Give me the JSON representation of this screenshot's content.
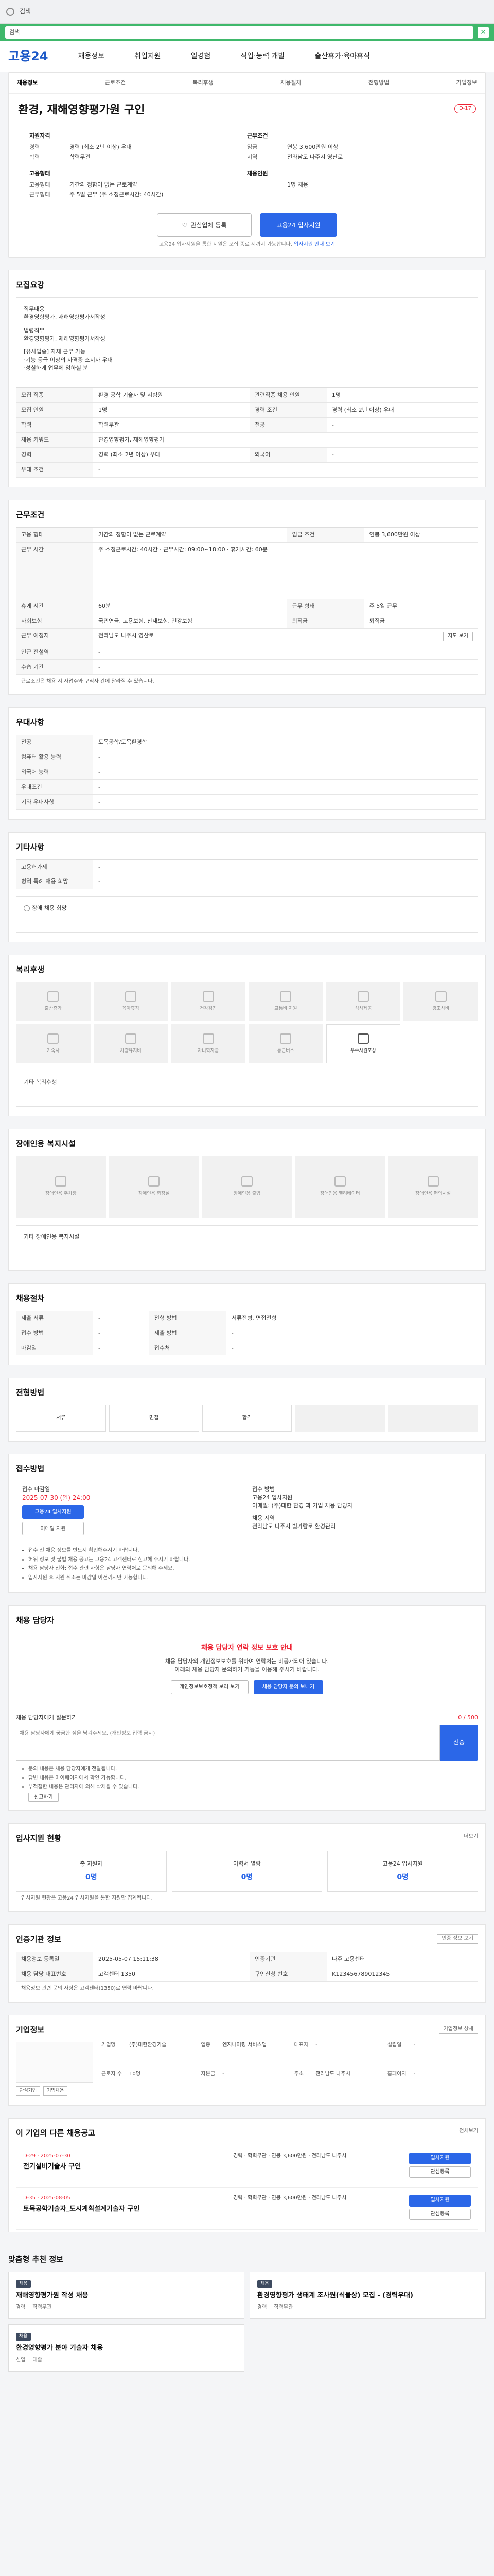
{
  "browser": {
    "search_text": "검색"
  },
  "top": {
    "search_text": "검색"
  },
  "gnb": {
    "logo": "고용24",
    "menus": [
      "채용정보",
      "취업지원",
      "일경험",
      "직업·능력 개발",
      "출산휴가·육아휴직"
    ]
  },
  "subnav": [
    "채용정보",
    "근로조건",
    "복리후생",
    "채용절차",
    "전형방법",
    "기업정보"
  ],
  "job": {
    "title": "환경, 재해영향평가원 구인",
    "badge": "D-17",
    "summary_left_title": "지원자격",
    "summary_left": [
      {
        "k": "경력",
        "v": "경력 (최소 2년 이상) 우대"
      },
      {
        "k": "학력",
        "v": "학력무관"
      }
    ],
    "summary_right_title": "근무조건",
    "summary_right": [
      {
        "k": "임금",
        "v": "연봉 3,600만원 이상"
      },
      {
        "k": "지역",
        "v": "전라남도 나주시 영산로"
      }
    ],
    "summary_left2_title": "고용형태",
    "summary_left2": [
      {
        "k": "고용형태",
        "v": "기간의 정함이 없는 근로계약"
      },
      {
        "k": "근무형태",
        "v": "주 5일 근무 (주 소정근로시간: 40시간)"
      }
    ],
    "summary_right2_title": "채용인원",
    "summary_right2": [
      {
        "k": "",
        "v": "1명 채용"
      }
    ],
    "scrap_btn": "관심업체 등록",
    "apply_btn": "고용24 입사지원",
    "note_pre": "고용24 입사지원을 통한 지원은 모집 종료 시까지 가능합니다.",
    "note_link": "입사지원 안내 보기"
  },
  "s_qual": {
    "title": "모집요강",
    "desc_lines": [
      "직무내용",
      "환경영향평가, 재해영향평가서작성",
      "",
      "법령직무",
      "환경영향평가, 재해영향평가서작성",
      "",
      "[유사업종] 자체 근무 가능",
      "·기능 등급 이상의 자격증 소지자 우대",
      "·성실하게 업무에 임하실 분"
    ],
    "rows": [
      {
        "k": "모집 직종",
        "v": "환경 공학 기술자 및 시험원",
        "k2": "관련직종 채용 인원",
        "v2": "1명"
      },
      {
        "k": "모집 인원",
        "v": "1명",
        "k2": "경력 조건",
        "v2": "경력 (최소 2년 이상) 우대"
      },
      {
        "k": "학력",
        "v": "학력무관",
        "k2": "전공",
        "v2": "-"
      },
      {
        "k": "채용 키워드",
        "v": "환경영향평가, 재해영향평가",
        "k2": "",
        "v2": ""
      },
      {
        "k": "경력",
        "v": "경력 (최소 2년 이상) 우대",
        "k2": "외국어",
        "v2": "-"
      },
      {
        "k": "우대 조건",
        "v": "-",
        "k2": "",
        "v2": ""
      }
    ]
  },
  "s_cond": {
    "title": "근무조건",
    "rows": [
      {
        "k": "고용 형태",
        "v": "기간의 정함이 없는 근로계약",
        "k2": "임금 조건",
        "v2": "연봉 3,600만원 이상"
      },
      {
        "k": "근무 시간",
        "v": "주 소정근로시간: 40시간 · 근무시간: 09:00~18:00 · 휴게시간: 60분",
        "k2": "",
        "v2": ""
      },
      {
        "k": "휴게 시간",
        "v": "60분",
        "k2": "근무 형태",
        "v2": "주 5일 근무"
      },
      {
        "k": "사회보험",
        "v": "국민연금, 고용보험, 산재보험, 건강보험",
        "k2": "퇴직금",
        "v2": "퇴직금"
      },
      {
        "k": "근무 예정지",
        "v": "전라남도 나주시 영산로",
        "k2": "",
        "v2": ""
      },
      {
        "k": "인근 전철역",
        "v": "-",
        "k2": "",
        "v2": ""
      },
      {
        "k": "수습 기간",
        "v": "-",
        "k2": "",
        "v2": ""
      }
    ],
    "map_btn": "지도 보기",
    "footnote": "근로조건은 채용 시 사업주와 구직자 간에 달라질 수 있습니다."
  },
  "s_benefit": {
    "title": "우대사항",
    "rows": [
      {
        "k": "전공",
        "v": "토목공학/토목환경학"
      },
      {
        "k": "컴퓨터 활용 능력",
        "v": "-"
      },
      {
        "k": "외국어 능력",
        "v": "-"
      },
      {
        "k": "우대조건",
        "v": "-"
      },
      {
        "k": "기타 우대사항",
        "v": "-"
      }
    ]
  },
  "s_extra": {
    "title": "기타사항",
    "rows": [
      {
        "k": "고용허가제",
        "v": "-"
      },
      {
        "k": "병역 특례 채용 희망",
        "v": "-"
      }
    ]
  },
  "s_disab": {
    "label": "장애 채용 희망"
  },
  "s_welfare": {
    "title": "복리후생",
    "items": [
      "출산휴가",
      "육아휴직",
      "건강검진",
      "교통비 지원",
      "식사제공",
      "경조사비",
      "기숙사",
      "차량유지비",
      "자녀학자금",
      "통근버스",
      "우수사원포상"
    ],
    "other_label": "기타 복리후생"
  },
  "s_facility": {
    "title": "장애인용 복지시설",
    "items": [
      "장애인용 주차장",
      "장애인용 화장실",
      "장애인용 출입",
      "장애인용 엘리베이터",
      "장애인용 편의시설"
    ],
    "other_label": "기타 장애인용 복지시설"
  },
  "s_process": {
    "title": "채용절차",
    "rows": [
      {
        "k": "제출 서류",
        "v": "-"
      },
      {
        "k": "전형 방법",
        "v": "서류전형, 면접전형"
      },
      {
        "k": "접수 방법",
        "v": "-"
      },
      {
        "k": "제출 방법",
        "v": "-"
      },
      {
        "k": "마감일",
        "v": "-"
      },
      {
        "k": "접수처",
        "v": "-"
      }
    ]
  },
  "s_method": {
    "title": "전형방법",
    "steps": [
      "서류",
      "면접",
      "합격",
      "",
      ""
    ]
  },
  "s_apply": {
    "title": "접수방법",
    "left_label": "접수 마감일",
    "deadline": "2025-07-30 (일) 24:00",
    "apply_btn": "고용24 입사지원",
    "mail_btn": "이메일 지원",
    "right_label": "접수 방법",
    "right_text1": "고용24 입사지원",
    "right_text2": "이메일: (주)대한 환경 과 기업 채용 담당자",
    "right_label2": "채용 지역",
    "right_text3": "전라남도 나주시 빛가람로 환경관리",
    "bullets": [
      "접수 전 채용 정보를 반드시 확인해주시기 바랍니다.",
      "허위 정보 및 불법 채용 공고는 고용24 고객센터로 신고해 주시기 바랍니다.",
      "채용 담당자 전화: 접수 관련 사항은 담당자 연락처로 문의해 주세요.",
      "입사지원 후 지원 취소는 마감일 이전까지만 가능합니다."
    ]
  },
  "s_contact": {
    "title": "채용 담당자",
    "warn": "채용 담당자 연락 정보 보호 안내",
    "text1": "채용 담당자의 개인정보보호를 위하여 연락처는 비공개되어 있습니다.",
    "text2": "아래의 채용 담당자 문의하기 기능을 이용해 주시기 바랍니다.",
    "btn1": "개인정보보호정책 보러 보기",
    "btn2": "채용 담당자 문의 보내기",
    "ask_label": "채용 담당자에게 질문하기",
    "ask_count": "0 / 500",
    "ask_placeholder": "채용 담당자에게 궁금한 점을 남겨주세요. (개인정보 입력 금지)",
    "send": "전송",
    "bullets": [
      "문의 내용은 채용 담당자에게 전달됩니다.",
      "답변 내용은 마이페이지에서 확인 가능합니다.",
      "부적절한 내용은 관리자에 의해 삭제될 수 있습니다."
    ],
    "report_btn": "신고하기"
  },
  "s_stats": {
    "title": "입사지원 현황",
    "more": "더보기",
    "items": [
      {
        "l": "총 지원자",
        "n": "0명"
      },
      {
        "l": "이력서 열람",
        "n": "0명"
      },
      {
        "l": "고용24 입사지원",
        "n": "0명"
      }
    ],
    "note": "입사지원 현황은 고용24 입사지원을 통한 지원만 집계됩니다."
  },
  "s_info": {
    "title": "인증기관 정보",
    "btn": "인증 정보 보기",
    "rows": [
      {
        "k": "채용정보 등록일",
        "v": "2025-05-07 15:11:38",
        "k2": "인증기관",
        "v2": "나주 고용센터"
      },
      {
        "k": "채용 담당 대표번호",
        "v": "고객센터 1350",
        "k2": "구인신청 번호",
        "v2": "K123456789012345"
      }
    ],
    "footnote": "채용정보 관련 문의 사항은 고객센터(1350)로 연락 바랍니다."
  },
  "s_corp": {
    "title": "기업정보",
    "btn": "기업정보 상세",
    "name": "(주)대한환경기술",
    "fields": [
      {
        "k": "기업명",
        "v": "(주)대한환경기술"
      },
      {
        "k": "업종",
        "v": "엔지니어링 서비스업"
      },
      {
        "k": "대표자",
        "v": "-"
      },
      {
        "k": "설립일",
        "v": "-"
      },
      {
        "k": "근로자 수",
        "v": "10명"
      },
      {
        "k": "자본금",
        "v": "-"
      },
      {
        "k": "주소",
        "v": "전라남도 나주시"
      },
      {
        "k": "홈페이지",
        "v": "-"
      }
    ],
    "btn_a": "관심기업",
    "btn_b": "기업채용"
  },
  "s_related": {
    "title": "이 기업의 다른 채용공고",
    "more": "전체보기",
    "items": [
      {
        "d": "D-29 · 2025-07-30",
        "t": "전기설비기술사 구인",
        "m": "경력 · 학력무관 · 연봉 3,600만원 · 전라남도 나주시"
      },
      {
        "d": "D-35 · 2025-08-05",
        "t": "토목공학기술자_도시계획설계기술자 구인",
        "m": "경력 · 학력무관 · 연봉 3,600만원 · 전라남도 나주시"
      }
    ],
    "btn_a": "입사지원",
    "btn_b": "관심등록"
  },
  "s_reco": {
    "title": "맞춤형 추천 정보",
    "items": [
      {
        "tg": "채용",
        "t": "재해영향평가원 작성 채용",
        "m1": "경력",
        "m2": "학력무관"
      },
      {
        "tg": "채용",
        "t": "환경영향평가 생태계 조사원(식물상) 모집 - (경력우대)",
        "m1": "경력",
        "m2": "학력무관"
      },
      {
        "tg": "채용",
        "t": "환경영향평가 분야 기술자 채용",
        "m1": "신입",
        "m2": "대졸"
      }
    ]
  }
}
